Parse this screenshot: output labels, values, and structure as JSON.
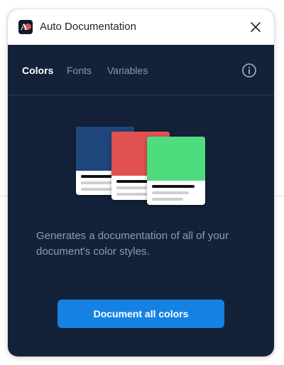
{
  "window": {
    "title": "Auto Documentation",
    "logo_text": "A",
    "close_icon": "close-icon"
  },
  "tabs": [
    {
      "label": "Colors",
      "active": true
    },
    {
      "label": "Fonts",
      "active": false
    },
    {
      "label": "Variables",
      "active": false
    }
  ],
  "info_icon": "info-icon",
  "illustration": {
    "cards": [
      {
        "color": "#1f467d"
      },
      {
        "color": "#e05252"
      },
      {
        "color": "#4fdc7f"
      }
    ]
  },
  "description": "Generates a documentation of all of your document's color styles.",
  "primary_action": {
    "label": "Document all colors",
    "color": "#1582e3"
  },
  "colors": {
    "panel_bg": "#132139",
    "titlebar_bg": "#ffffff",
    "tab_active": "#ffffff",
    "tab_inactive": "#8c97aa"
  }
}
